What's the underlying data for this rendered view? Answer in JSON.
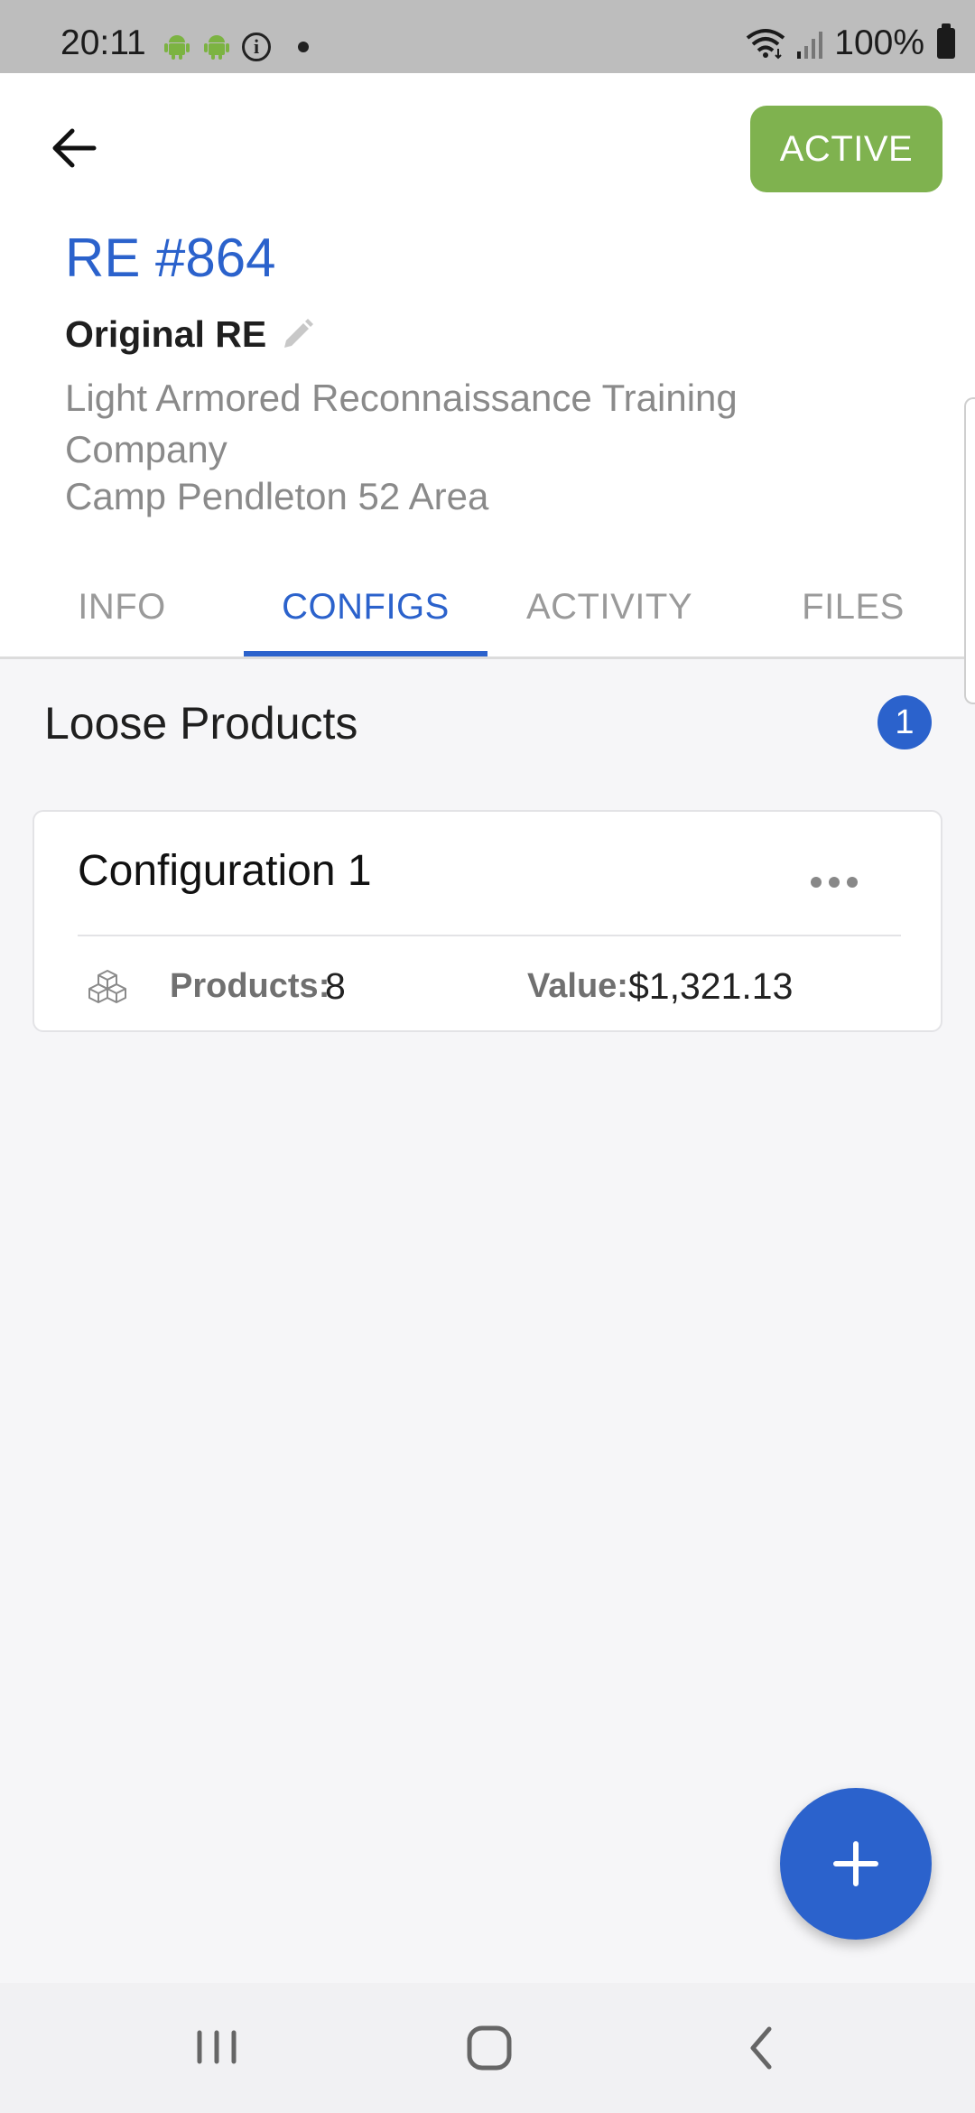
{
  "status_bar": {
    "time": "20:11",
    "battery": "100%",
    "icons": [
      "android-icon",
      "android-icon",
      "info-icon",
      "notification-dot-icon",
      "wifi-icon",
      "signal-icon",
      "battery-icon"
    ]
  },
  "header": {
    "status_label": "ACTIVE",
    "status_color": "#7fb24f",
    "title": "RE #864",
    "subtitle": "Original RE",
    "organization": "Light Armored Reconnaissance Training Company",
    "location": "Camp Pendleton 52 Area"
  },
  "tabs": [
    {
      "label": "INFO",
      "active": false
    },
    {
      "label": "CONFIGS",
      "active": true
    },
    {
      "label": "ACTIVITY",
      "active": false
    },
    {
      "label": "FILES",
      "active": false
    }
  ],
  "section": {
    "title": "Loose Products",
    "count": "1"
  },
  "configurations": [
    {
      "title": "Configuration 1",
      "products_label": "Products:",
      "products_value": "8",
      "value_label": "Value:",
      "value_amount": "$1,321.13"
    }
  ],
  "colors": {
    "accent": "#2b62cc",
    "active_green": "#7fb24f"
  }
}
